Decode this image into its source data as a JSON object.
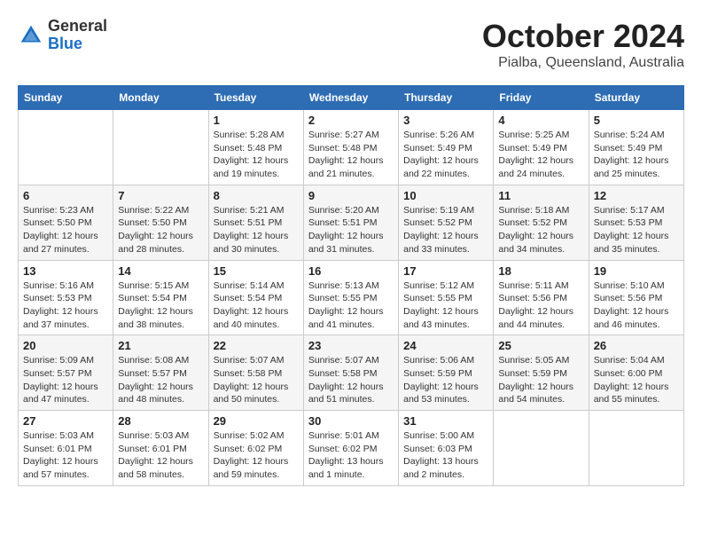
{
  "header": {
    "logo": {
      "general": "General",
      "blue": "Blue"
    },
    "title": "October 2024",
    "location": "Pialba, Queensland, Australia"
  },
  "calendar": {
    "weekdays": [
      "Sunday",
      "Monday",
      "Tuesday",
      "Wednesday",
      "Thursday",
      "Friday",
      "Saturday"
    ],
    "weeks": [
      [
        {
          "day": "",
          "info": ""
        },
        {
          "day": "",
          "info": ""
        },
        {
          "day": "1",
          "info": "Sunrise: 5:28 AM\nSunset: 5:48 PM\nDaylight: 12 hours\nand 19 minutes."
        },
        {
          "day": "2",
          "info": "Sunrise: 5:27 AM\nSunset: 5:48 PM\nDaylight: 12 hours\nand 21 minutes."
        },
        {
          "day": "3",
          "info": "Sunrise: 5:26 AM\nSunset: 5:49 PM\nDaylight: 12 hours\nand 22 minutes."
        },
        {
          "day": "4",
          "info": "Sunrise: 5:25 AM\nSunset: 5:49 PM\nDaylight: 12 hours\nand 24 minutes."
        },
        {
          "day": "5",
          "info": "Sunrise: 5:24 AM\nSunset: 5:49 PM\nDaylight: 12 hours\nand 25 minutes."
        }
      ],
      [
        {
          "day": "6",
          "info": "Sunrise: 5:23 AM\nSunset: 5:50 PM\nDaylight: 12 hours\nand 27 minutes."
        },
        {
          "day": "7",
          "info": "Sunrise: 5:22 AM\nSunset: 5:50 PM\nDaylight: 12 hours\nand 28 minutes."
        },
        {
          "day": "8",
          "info": "Sunrise: 5:21 AM\nSunset: 5:51 PM\nDaylight: 12 hours\nand 30 minutes."
        },
        {
          "day": "9",
          "info": "Sunrise: 5:20 AM\nSunset: 5:51 PM\nDaylight: 12 hours\nand 31 minutes."
        },
        {
          "day": "10",
          "info": "Sunrise: 5:19 AM\nSunset: 5:52 PM\nDaylight: 12 hours\nand 33 minutes."
        },
        {
          "day": "11",
          "info": "Sunrise: 5:18 AM\nSunset: 5:52 PM\nDaylight: 12 hours\nand 34 minutes."
        },
        {
          "day": "12",
          "info": "Sunrise: 5:17 AM\nSunset: 5:53 PM\nDaylight: 12 hours\nand 35 minutes."
        }
      ],
      [
        {
          "day": "13",
          "info": "Sunrise: 5:16 AM\nSunset: 5:53 PM\nDaylight: 12 hours\nand 37 minutes."
        },
        {
          "day": "14",
          "info": "Sunrise: 5:15 AM\nSunset: 5:54 PM\nDaylight: 12 hours\nand 38 minutes."
        },
        {
          "day": "15",
          "info": "Sunrise: 5:14 AM\nSunset: 5:54 PM\nDaylight: 12 hours\nand 40 minutes."
        },
        {
          "day": "16",
          "info": "Sunrise: 5:13 AM\nSunset: 5:55 PM\nDaylight: 12 hours\nand 41 minutes."
        },
        {
          "day": "17",
          "info": "Sunrise: 5:12 AM\nSunset: 5:55 PM\nDaylight: 12 hours\nand 43 minutes."
        },
        {
          "day": "18",
          "info": "Sunrise: 5:11 AM\nSunset: 5:56 PM\nDaylight: 12 hours\nand 44 minutes."
        },
        {
          "day": "19",
          "info": "Sunrise: 5:10 AM\nSunset: 5:56 PM\nDaylight: 12 hours\nand 46 minutes."
        }
      ],
      [
        {
          "day": "20",
          "info": "Sunrise: 5:09 AM\nSunset: 5:57 PM\nDaylight: 12 hours\nand 47 minutes."
        },
        {
          "day": "21",
          "info": "Sunrise: 5:08 AM\nSunset: 5:57 PM\nDaylight: 12 hours\nand 48 minutes."
        },
        {
          "day": "22",
          "info": "Sunrise: 5:07 AM\nSunset: 5:58 PM\nDaylight: 12 hours\nand 50 minutes."
        },
        {
          "day": "23",
          "info": "Sunrise: 5:07 AM\nSunset: 5:58 PM\nDaylight: 12 hours\nand 51 minutes."
        },
        {
          "day": "24",
          "info": "Sunrise: 5:06 AM\nSunset: 5:59 PM\nDaylight: 12 hours\nand 53 minutes."
        },
        {
          "day": "25",
          "info": "Sunrise: 5:05 AM\nSunset: 5:59 PM\nDaylight: 12 hours\nand 54 minutes."
        },
        {
          "day": "26",
          "info": "Sunrise: 5:04 AM\nSunset: 6:00 PM\nDaylight: 12 hours\nand 55 minutes."
        }
      ],
      [
        {
          "day": "27",
          "info": "Sunrise: 5:03 AM\nSunset: 6:01 PM\nDaylight: 12 hours\nand 57 minutes."
        },
        {
          "day": "28",
          "info": "Sunrise: 5:03 AM\nSunset: 6:01 PM\nDaylight: 12 hours\nand 58 minutes."
        },
        {
          "day": "29",
          "info": "Sunrise: 5:02 AM\nSunset: 6:02 PM\nDaylight: 12 hours\nand 59 minutes."
        },
        {
          "day": "30",
          "info": "Sunrise: 5:01 AM\nSunset: 6:02 PM\nDaylight: 13 hours\nand 1 minute."
        },
        {
          "day": "31",
          "info": "Sunrise: 5:00 AM\nSunset: 6:03 PM\nDaylight: 13 hours\nand 2 minutes."
        },
        {
          "day": "",
          "info": ""
        },
        {
          "day": "",
          "info": ""
        }
      ]
    ]
  }
}
